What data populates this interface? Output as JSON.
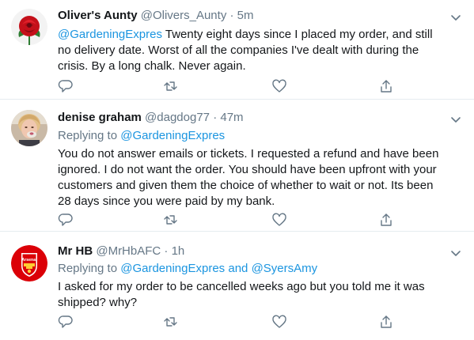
{
  "tweets": [
    {
      "name": "Oliver's Aunty",
      "handle": "@Olivers_Aunty",
      "separator": "·",
      "time": "5m",
      "mention": "@GardeningExpres",
      "text_line1_rest": " Twenty eight days since I placed my order, and still",
      "text_line2": "no delivery date. Worst of all the companies I've dealt with during the",
      "text_line3": "crisis. By a long chalk. Never again.",
      "avatar_icon": "red-rose-avatar"
    },
    {
      "name": "denise graham",
      "handle": "@dagdog77",
      "separator": "·",
      "time": "47m",
      "replying_prefix": "Replying to ",
      "replying_to": "@GardeningExpres",
      "text_lines": [
        "You do not answer emails or tickets. I requested a refund and have been",
        "ignored. I do not want the order. You should have been upfront with your",
        "customers and given them the choice of whether to wait or not. Its been",
        "28 days since you were paid by my bank."
      ],
      "avatar_icon": "person-photo-avatar"
    },
    {
      "name": "Mr HB",
      "handle": "@MrHbAFC",
      "separator": "·",
      "time": "1h",
      "replying_prefix": "Replying to ",
      "replying_to_1": "@GardeningExpres",
      "replying_and": " and ",
      "replying_to_2": "@SyersAmy",
      "text_lines": [
        "I asked for my order to be cancelled weeks ago but you told me it was",
        "shipped? why?"
      ],
      "avatar_icon": "arsenal-crest-avatar",
      "avatar_text": "Arsenal"
    }
  ],
  "icons": {
    "reply": "reply-icon",
    "retweet": "retweet-icon",
    "like": "heart-icon",
    "share": "share-icon",
    "more": "chevron-down-icon"
  },
  "colors": {
    "link": "#1b95e0",
    "secondary_text": "#657786",
    "divider": "#e6ecf0",
    "arsenal_red": "#db0007"
  }
}
